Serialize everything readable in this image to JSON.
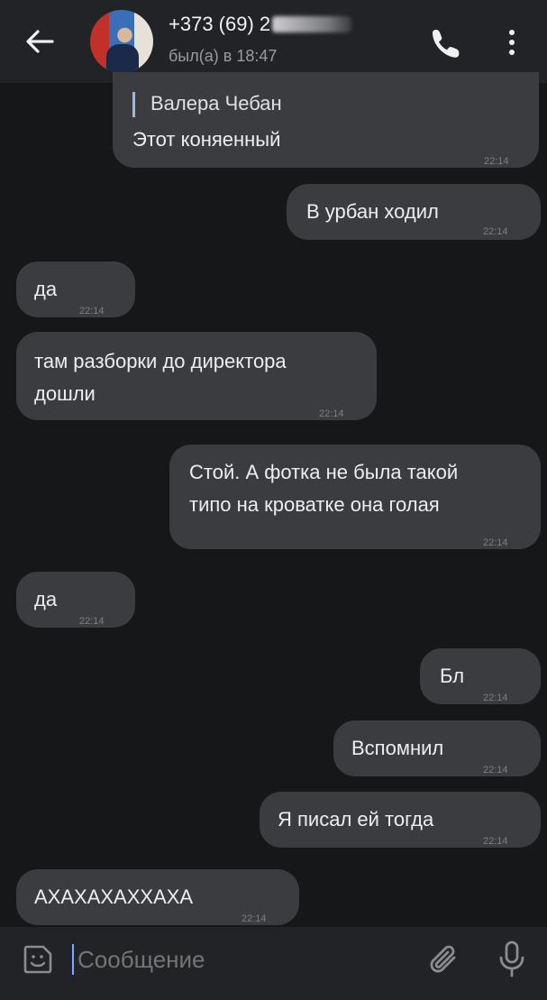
{
  "header": {
    "back_icon": "arrow-left-icon",
    "contact_name": "+373 (69) 2",
    "status": "был(а) в 18:47",
    "call_icon": "phone-icon",
    "menu_icon": "more-vertical-icon"
  },
  "messages": [
    {
      "direction": "incoming",
      "reply_to": "Валера Чебан",
      "lines": [
        "Этот коняенный"
      ],
      "time": "22:14"
    },
    {
      "direction": "outgoing",
      "lines": [
        "В урбан ходил"
      ],
      "time": "22:14"
    },
    {
      "direction": "incoming",
      "lines": [
        "да"
      ],
      "time": "22:14"
    },
    {
      "direction": "incoming",
      "lines": [
        "там разборки до директора",
        "дошли"
      ],
      "time": "22:14"
    },
    {
      "direction": "outgoing",
      "lines": [
        "Стой. А фотка не была такой",
        "типо на кроватке она голая"
      ],
      "time": "22:14"
    },
    {
      "direction": "incoming",
      "lines": [
        "да"
      ],
      "time": "22:14"
    },
    {
      "direction": "outgoing",
      "lines": [
        "Бл"
      ],
      "time": "22:14"
    },
    {
      "direction": "outgoing",
      "lines": [
        "Вспомнил"
      ],
      "time": "22:14"
    },
    {
      "direction": "outgoing",
      "lines": [
        "Я писал ей тогда"
      ],
      "time": "22:14"
    },
    {
      "direction": "incoming",
      "lines": [
        "АХАХАХАХХАХА"
      ],
      "time": "22:14"
    }
  ],
  "composer": {
    "placeholder": "Сообщение",
    "emoji_icon": "sticker-emoji-icon",
    "attach_icon": "paperclip-icon",
    "mic_icon": "microphone-icon"
  },
  "colors": {
    "background": "#161719",
    "header": "#222326",
    "bubble": "#3b3c40",
    "reply_accent": "#9ab7e8",
    "cursor": "#7fa9ff"
  }
}
